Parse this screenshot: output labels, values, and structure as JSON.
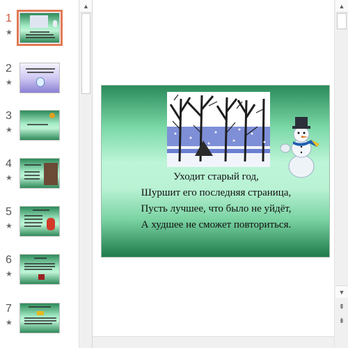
{
  "slides": [
    {
      "number": "1",
      "star": "★"
    },
    {
      "number": "2",
      "star": "★"
    },
    {
      "number": "3",
      "star": "★"
    },
    {
      "number": "4",
      "star": "★"
    },
    {
      "number": "5",
      "star": "★"
    },
    {
      "number": "6",
      "star": "★"
    },
    {
      "number": "7",
      "star": "★"
    }
  ],
  "selected_slide": 1,
  "icons": {
    "scroll_up": "▲",
    "scroll_down": "▼",
    "prev_slide": "⇞",
    "next_slide": "⇟"
  },
  "current_slide": {
    "poem_lines": [
      "Уходит старый год,",
      "Шуршит его последняя страница,",
      "Пусть лучшее, что было не уйдёт,",
      "А худшее не сможет повториться."
    ]
  },
  "colors": {
    "selected_outline": "#e07a54",
    "slide_green": "#7cd9a8",
    "slide_dark_green": "#1f7b4b"
  }
}
